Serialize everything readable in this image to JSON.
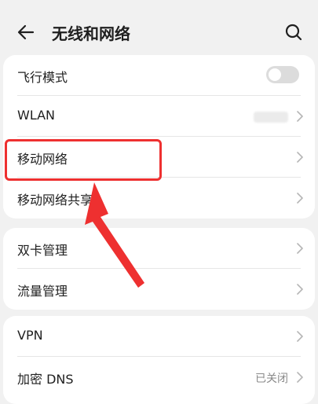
{
  "header": {
    "title": "无线和网络"
  },
  "groups": [
    {
      "items": [
        {
          "label": "飞行模式",
          "type": "toggle",
          "state": "off"
        },
        {
          "label": "WLAN",
          "type": "link"
        },
        {
          "label": "移动网络",
          "type": "link",
          "highlighted": true
        },
        {
          "label": "移动网络共享",
          "type": "link"
        }
      ]
    },
    {
      "items": [
        {
          "label": "双卡管理",
          "type": "link"
        },
        {
          "label": "流量管理",
          "type": "link"
        }
      ]
    },
    {
      "items": [
        {
          "label": "VPN",
          "type": "link"
        },
        {
          "label": "加密 DNS",
          "type": "link",
          "value": "已关闭"
        }
      ]
    }
  ],
  "colors": {
    "highlight": "#ee3030",
    "background": "#f1f1f1",
    "card": "#ffffff"
  },
  "icons": [
    "back-arrow-icon",
    "search-icon",
    "chevron-right-icon"
  ]
}
